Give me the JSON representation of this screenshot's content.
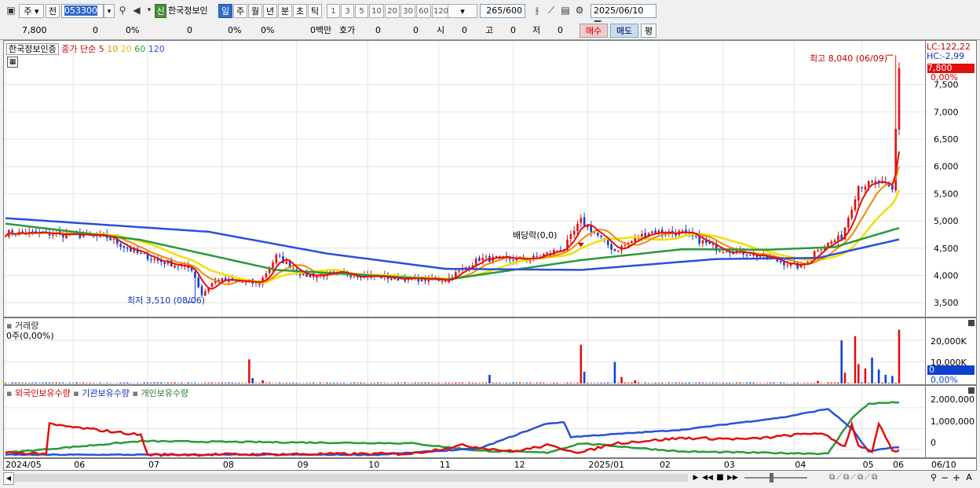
{
  "toolbar": {
    "type_label": "주",
    "prev_label": "전",
    "code": "053300",
    "new_badge": "신",
    "stock_name": "한국정보인",
    "periods": [
      "일",
      "주",
      "월",
      "년",
      "분",
      "초",
      "틱"
    ],
    "period_active": 0,
    "minute_options": [
      "1",
      "3",
      "5",
      "10",
      "20",
      "30",
      "60",
      "120"
    ],
    "count": "265",
    "count_max": "/600",
    "date": "2025/06/10"
  },
  "quote": {
    "price": "7,800",
    "change": "0",
    "change_pct": "0%",
    "c4": "0",
    "c5": "0%",
    "c6": "0%",
    "amount": "0백만",
    "hoga_label": "호가",
    "hoga_v1": "0",
    "hoga_v2": "0",
    "open_label": "시",
    "open_v": "0",
    "high_label": "고",
    "high_v": "0",
    "low_label": "저",
    "low_v": "0",
    "buy": "매수",
    "sell": "매도",
    "avg": "평"
  },
  "legend": {
    "name": "한국정보인증",
    "price_label": "종가 단순",
    "ma": [
      "5",
      "10",
      "20",
      "60",
      "120"
    ]
  },
  "colors": {
    "ma5": "#e01010",
    "ma10": "#f08a00",
    "ma20": "#f0e000",
    "ma60": "#2a9a3a",
    "ma120": "#2a50d8",
    "up": "#e01010",
    "down": "#1040d0",
    "foreign": "#e01010",
    "inst": "#2a50d8",
    "retail": "#2a9a3a"
  },
  "annotations": {
    "high": "최고 8,040 (06/09)",
    "low": "최저 3,510 (08/06)",
    "dividend": "배당락(0,0)"
  },
  "right_axis": {
    "lc": "LC:122,22",
    "hc": "HC:-2,99",
    "last_price": "7,800",
    "last_pct": "0,00%"
  },
  "volume": {
    "label": "거래량",
    "value": "0주(0,00%)",
    "current": "0",
    "pct": "0,00%",
    "ticks": [
      "20,000K",
      "10,000K"
    ]
  },
  "holdings": {
    "labels": [
      "외국인보유수량",
      "기관보유수량",
      "개인보유수량"
    ],
    "ticks": [
      "2,000,000",
      "1,000,000",
      "0"
    ]
  },
  "x_labels": [
    "2024/05",
    "06",
    "07",
    "08",
    "09",
    "10",
    "11",
    "12",
    "2025/01",
    "02",
    "03",
    "04",
    "05",
    "06",
    "06/10"
  ],
  "chart_data": {
    "type": "line",
    "title": "",
    "ylim": [
      3300,
      8100
    ],
    "yticks": [
      3500,
      4000,
      4500,
      5000,
      5500,
      6000,
      6500,
      7000,
      7500
    ],
    "close_anchors": [
      [
        0,
        4780
      ],
      [
        15,
        4760
      ],
      [
        30,
        4700
      ],
      [
        38,
        4430
      ],
      [
        45,
        4270
      ],
      [
        55,
        4120
      ],
      [
        58,
        3650
      ],
      [
        62,
        3920
      ],
      [
        75,
        3850
      ],
      [
        80,
        4350
      ],
      [
        88,
        4000
      ],
      [
        100,
        4030
      ],
      [
        115,
        3950
      ],
      [
        130,
        3920
      ],
      [
        140,
        4300
      ],
      [
        155,
        4300
      ],
      [
        165,
        4500
      ],
      [
        170,
        5000
      ],
      [
        180,
        4450
      ],
      [
        190,
        4800
      ],
      [
        200,
        4780
      ],
      [
        210,
        4500
      ],
      [
        220,
        4400
      ],
      [
        235,
        4150
      ],
      [
        240,
        4500
      ],
      [
        247,
        4700
      ],
      [
        252,
        5650
      ],
      [
        258,
        5700
      ],
      [
        262,
        5550
      ],
      [
        264,
        7800
      ]
    ],
    "ma60_anchors": [
      [
        0,
        4950
      ],
      [
        40,
        4650
      ],
      [
        80,
        4100
      ],
      [
        130,
        3920
      ],
      [
        170,
        4280
      ],
      [
        200,
        4480
      ],
      [
        225,
        4470
      ],
      [
        245,
        4520
      ],
      [
        264,
        4870
      ]
    ],
    "ma120_anchors": [
      [
        0,
        5050
      ],
      [
        60,
        4800
      ],
      [
        95,
        4400
      ],
      [
        130,
        4120
      ],
      [
        170,
        4100
      ],
      [
        210,
        4300
      ],
      [
        240,
        4320
      ],
      [
        264,
        4660
      ]
    ],
    "volume_spikes": [
      [
        17,
        400
      ],
      [
        72,
        11200
      ],
      [
        73,
        2500
      ],
      [
        76,
        1500
      ],
      [
        143,
        4000
      ],
      [
        170,
        18000
      ],
      [
        171,
        5500
      ],
      [
        180,
        10000
      ],
      [
        182,
        3000
      ],
      [
        186,
        1500
      ],
      [
        240,
        1200
      ],
      [
        247,
        20000
      ],
      [
        248,
        5000
      ],
      [
        251,
        22000
      ],
      [
        252,
        9000
      ],
      [
        254,
        7000
      ],
      [
        256,
        12000
      ],
      [
        258,
        6500
      ],
      [
        260,
        4000
      ],
      [
        262,
        3500
      ],
      [
        264,
        25000
      ]
    ],
    "volume_ylim": [
      0,
      27000
    ],
    "holdings_ylim": [
      -300000,
      2600000
    ],
    "foreign_anchors": [
      [
        0,
        -150000
      ],
      [
        12,
        -200000
      ],
      [
        13,
        1200000
      ],
      [
        40,
        700000
      ],
      [
        42,
        -250000
      ],
      [
        120,
        -200000
      ],
      [
        135,
        200000
      ],
      [
        150,
        -100000
      ],
      [
        160,
        200000
      ],
      [
        170,
        -150000
      ],
      [
        180,
        300000
      ],
      [
        200,
        550000
      ],
      [
        220,
        500000
      ],
      [
        240,
        800000
      ],
      [
        243,
        600000
      ],
      [
        248,
        150000
      ],
      [
        250,
        1200000
      ],
      [
        252,
        200000
      ],
      [
        256,
        -80000
      ],
      [
        258,
        1200000
      ],
      [
        260,
        600000
      ],
      [
        262,
        -100000
      ]
    ],
    "inst_anchors": [
      [
        0,
        -250000
      ],
      [
        110,
        -250000
      ],
      [
        140,
        50000
      ],
      [
        160,
        1250000
      ],
      [
        165,
        1300000
      ],
      [
        167,
        600000
      ],
      [
        200,
        950000
      ],
      [
        230,
        1550000
      ],
      [
        243,
        1950000
      ],
      [
        250,
        1000000
      ],
      [
        255,
        -100000
      ],
      [
        262,
        100000
      ]
    ],
    "retail_anchors": [
      [
        0,
        -150000
      ],
      [
        40,
        400000
      ],
      [
        120,
        300000
      ],
      [
        140,
        -60000
      ],
      [
        160,
        -150000
      ],
      [
        170,
        300000
      ],
      [
        200,
        -100000
      ],
      [
        243,
        -200000
      ],
      [
        250,
        1500000
      ],
      [
        255,
        2200000
      ],
      [
        262,
        2250000
      ]
    ],
    "n_days": 265
  }
}
